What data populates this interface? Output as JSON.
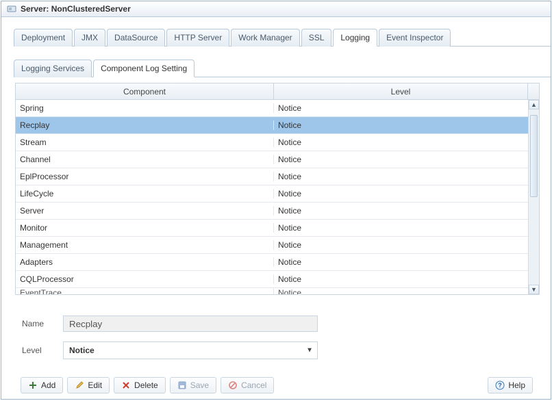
{
  "window": {
    "title_prefix": "Server: ",
    "server_name": "NonClusteredServer"
  },
  "main_tabs": [
    {
      "label": "Deployment",
      "active": false
    },
    {
      "label": "JMX",
      "active": false
    },
    {
      "label": "DataSource",
      "active": false
    },
    {
      "label": "HTTP Server",
      "active": false
    },
    {
      "label": "Work Manager",
      "active": false
    },
    {
      "label": "SSL",
      "active": false
    },
    {
      "label": "Logging",
      "active": true
    },
    {
      "label": "Event Inspector",
      "active": false
    }
  ],
  "sub_tabs": [
    {
      "label": "Logging Services",
      "active": false
    },
    {
      "label": "Component Log Setting",
      "active": true
    }
  ],
  "table": {
    "columns": {
      "component": "Component",
      "level": "Level"
    },
    "rows": [
      {
        "component": "Spring",
        "level": "Notice",
        "selected": false
      },
      {
        "component": "Recplay",
        "level": "Notice",
        "selected": true
      },
      {
        "component": "Stream",
        "level": "Notice",
        "selected": false
      },
      {
        "component": "Channel",
        "level": "Notice",
        "selected": false
      },
      {
        "component": "EplProcessor",
        "level": "Notice",
        "selected": false
      },
      {
        "component": "LifeCycle",
        "level": "Notice",
        "selected": false
      },
      {
        "component": "Server",
        "level": "Notice",
        "selected": false
      },
      {
        "component": "Monitor",
        "level": "Notice",
        "selected": false
      },
      {
        "component": "Management",
        "level": "Notice",
        "selected": false
      },
      {
        "component": "Adapters",
        "level": "Notice",
        "selected": false
      },
      {
        "component": "CQLProcessor",
        "level": "Notice",
        "selected": false
      }
    ],
    "partial_row": {
      "component": "EventTrace",
      "level": "Notice"
    }
  },
  "form": {
    "name_label": "Name",
    "name_value": "Recplay",
    "level_label": "Level",
    "level_value": "Notice"
  },
  "buttons": {
    "add": "Add",
    "edit": "Edit",
    "delete": "Delete",
    "save": "Save",
    "cancel": "Cancel",
    "help": "Help"
  }
}
